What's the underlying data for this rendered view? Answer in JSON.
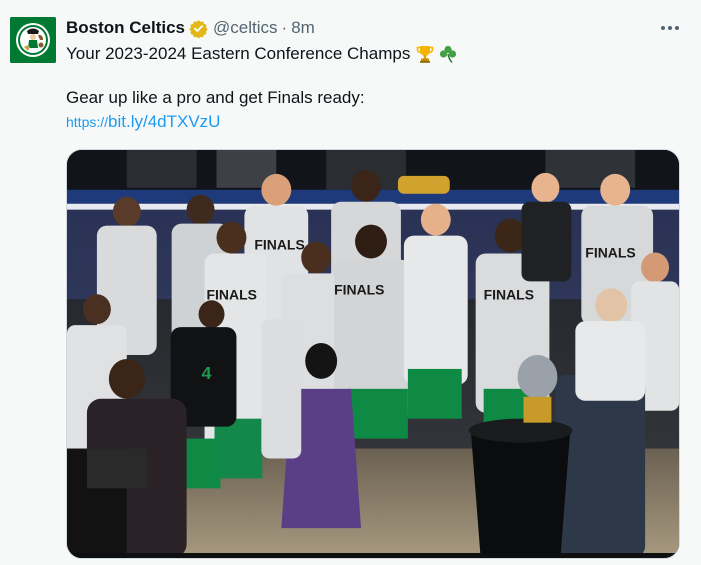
{
  "tweet": {
    "author": {
      "display_name": "Boston Celtics",
      "handle": "@celtics",
      "separator": "·",
      "time": "8m",
      "avatar_icon": "celtics-logo-icon",
      "verified_icon": "gold-verified-badge-icon"
    },
    "text": {
      "line1": "Your 2023-2024 Eastern Conference Champs",
      "line1_emojis": [
        "trophy-emoji",
        "shamrock-emoji"
      ],
      "line2": "Gear up like a pro and get Finals ready:"
    },
    "link": {
      "protocol": "https://",
      "rest": "bit.ly/4dTXVzU"
    },
    "media": {
      "caption_shirts": "FINALS",
      "jersey_number": "4"
    },
    "more_icon": "more-dots-icon"
  },
  "colors": {
    "brand_green": "#007a33",
    "link_blue": "#1d9bf0",
    "muted_gray": "#536471",
    "verified_gold": "#e2b719"
  }
}
